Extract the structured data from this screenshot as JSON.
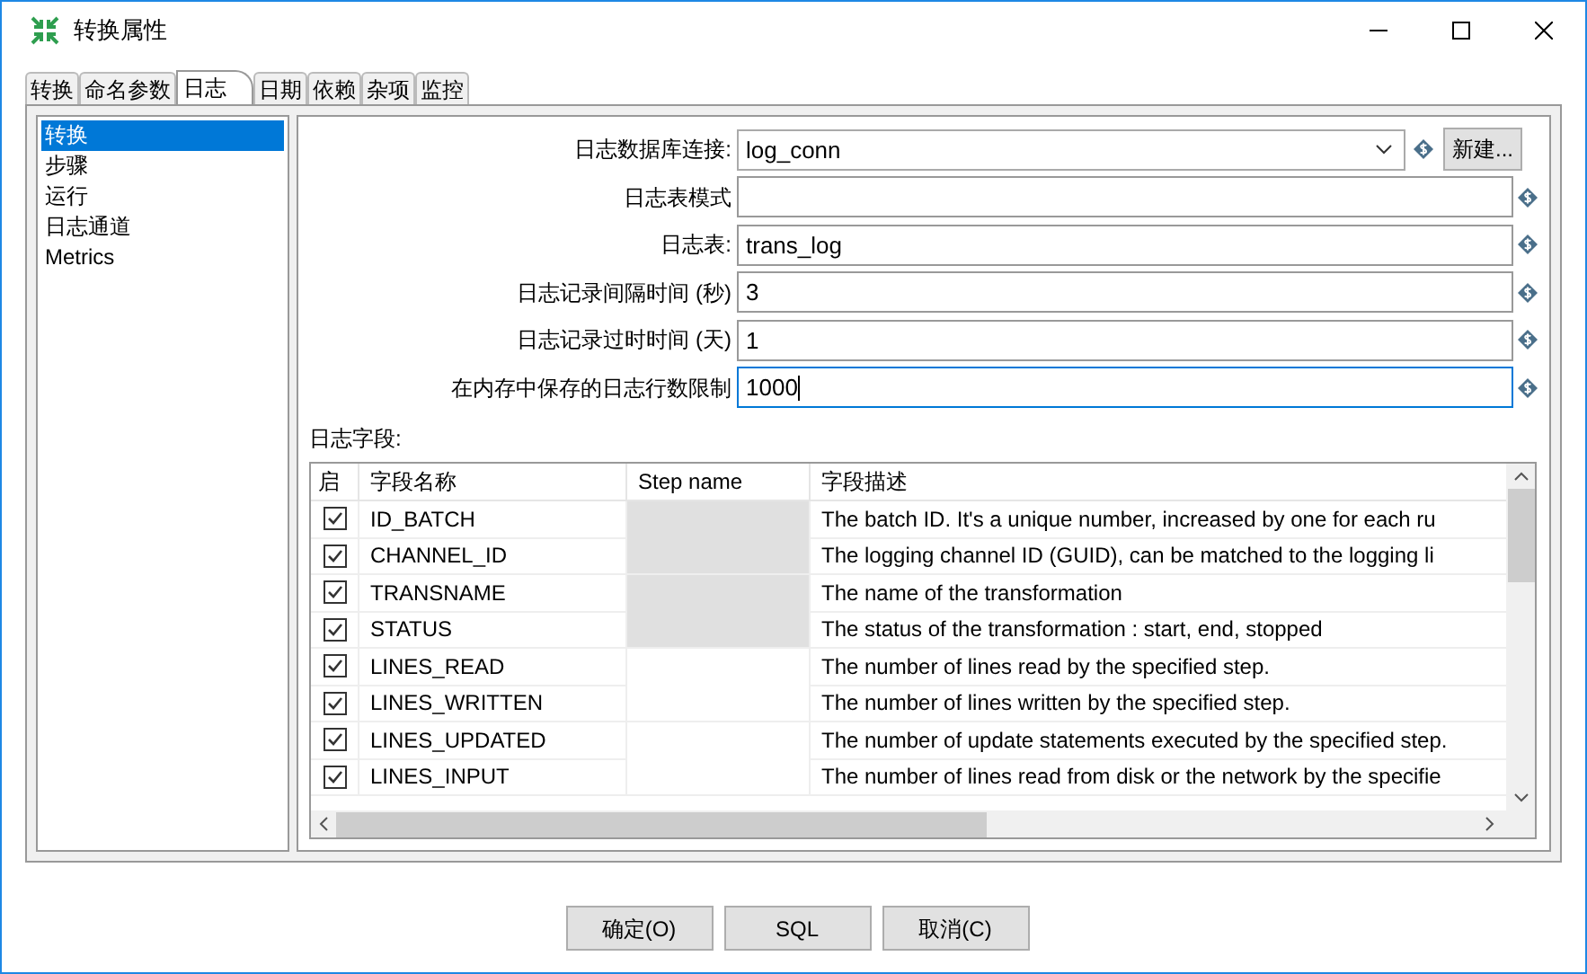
{
  "window": {
    "title": "转换属性"
  },
  "tabs": [
    {
      "label": "转换",
      "selected": false
    },
    {
      "label": "命名参数",
      "selected": false
    },
    {
      "label": "日志",
      "selected": true
    },
    {
      "label": "日期",
      "selected": false
    },
    {
      "label": "依赖",
      "selected": false
    },
    {
      "label": "杂项",
      "selected": false
    },
    {
      "label": "监控",
      "selected": false
    }
  ],
  "sidebar": {
    "items": [
      {
        "label": "转换",
        "selected": true
      },
      {
        "label": "步骤",
        "selected": false
      },
      {
        "label": "运行",
        "selected": false
      },
      {
        "label": "日志通道",
        "selected": false
      },
      {
        "label": "Metrics",
        "selected": false
      }
    ]
  },
  "form": {
    "fields": [
      {
        "kind": "dropdown",
        "label": "日志数据库连接:",
        "value": "log_conn",
        "button": "新建..."
      },
      {
        "kind": "text",
        "label": "日志表模式"
      },
      {
        "kind": "text",
        "label": "日志表:",
        "value": "trans_log"
      },
      {
        "kind": "text",
        "label": "日志记录间隔时间 (秒)",
        "value": "3"
      },
      {
        "kind": "text",
        "label": "日志记录过时时间 (天)",
        "value": "1"
      },
      {
        "kind": "text",
        "label": "在内存中保存的日志行数限制",
        "value": "1000",
        "focused": true
      }
    ]
  },
  "log_fields": {
    "label": "日志字段:",
    "columns": [
      "启",
      "字段名称",
      "Step name",
      "字段描述"
    ],
    "rows": [
      {
        "checked": true,
        "name": "ID_BATCH",
        "step_disabled": true,
        "description": "The batch ID. It's a unique number, increased by one for each ru"
      },
      {
        "checked": true,
        "name": "CHANNEL_ID",
        "step_disabled": true,
        "description": "The logging channel ID (GUID), can be matched to the logging li"
      },
      {
        "checked": true,
        "name": "TRANSNAME",
        "step_disabled": true,
        "description": "The name of the transformation"
      },
      {
        "checked": true,
        "name": "STATUS",
        "step_disabled": true,
        "description": "The status of the transformation : start, end, stopped"
      },
      {
        "checked": true,
        "name": "LINES_READ",
        "step_disabled": false,
        "description": "The number of lines read by the specified step."
      },
      {
        "checked": true,
        "name": "LINES_WRITTEN",
        "step_disabled": false,
        "description": "The number of lines written by the specified step."
      },
      {
        "checked": true,
        "name": "LINES_UPDATED",
        "step_disabled": false,
        "description": "The number of update statements executed by the specified step."
      },
      {
        "checked": true,
        "name": "LINES_INPUT",
        "step_disabled": false,
        "description": "The number of lines read from disk or the network by the specifie"
      }
    ]
  },
  "buttons": [
    "确定(O)",
    "SQL",
    "取消(C)"
  ]
}
